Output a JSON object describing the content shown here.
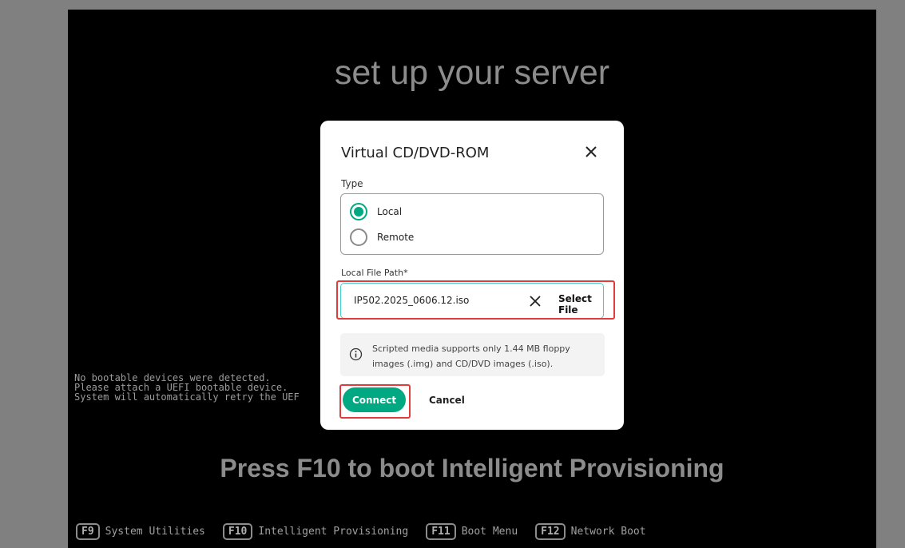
{
  "console": {
    "title": "set up your server",
    "messages": [
      "No bootable devices were detected.",
      "Please attach a UEFI bootable device.",
      "System will automatically retry the UEF"
    ],
    "press_line": "Press F10 to boot Intelligent Provisioning",
    "function_keys": [
      {
        "key": "F9",
        "label": "System Utilities"
      },
      {
        "key": "F10",
        "label": "Intelligent Provisioning"
      },
      {
        "key": "F11",
        "label": "Boot Menu"
      },
      {
        "key": "F12",
        "label": "Network Boot"
      }
    ]
  },
  "dialog": {
    "title": "Virtual CD/DVD-ROM",
    "close_icon": "close-icon",
    "type_label": "Type",
    "type_options": [
      {
        "label": "Local",
        "checked": true
      },
      {
        "label": "Remote",
        "checked": false
      }
    ],
    "path_label": "Local File Path*",
    "path_value": "IP502.2025_0606.12.iso",
    "select_file_label": "Select File",
    "info_text": "Scripted media supports only 1.44 MB floppy images (.img) and CD/DVD images (.iso).",
    "connect_label": "Connect",
    "cancel_label": "Cancel"
  },
  "colors": {
    "accent": "#01a982",
    "highlight": "#e03c3c",
    "input_focus": "#3fcfd0"
  }
}
